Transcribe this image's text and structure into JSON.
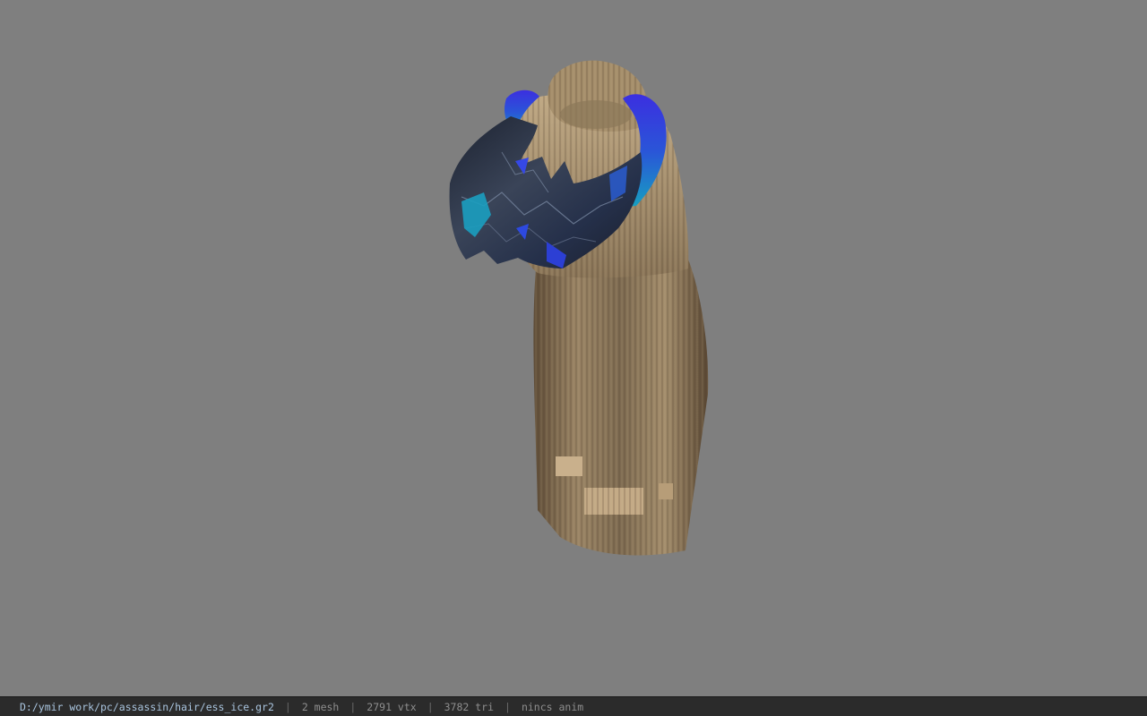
{
  "status_bar": {
    "file_path": "D:/ymir work/pc/assassin/hair/ess_ice.gr2",
    "separator": "|",
    "mesh_count": "2 mesh",
    "vertex_count": "2791 vtx",
    "triangle_count": "3782 tri",
    "animation": "nincs anim"
  },
  "colors": {
    "viewport_background": "#7f7f7f",
    "statusbar_background": "#2b2b2b",
    "path_text": "#a9c4de",
    "info_text": "#8e8e8e",
    "hair_base": "#8a7558",
    "hair_highlight": "#b9a27e",
    "hair_shadow": "#5e4c37",
    "horn_dark": "#2c3444",
    "horn_blue": "#2a3fd6",
    "horn_cyan": "#1ea3c4"
  }
}
